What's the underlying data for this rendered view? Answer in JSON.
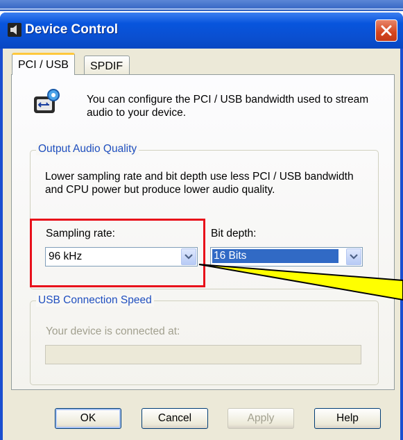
{
  "window": {
    "title": "Device Control"
  },
  "tabs": [
    {
      "label": "PCI / USB",
      "active": true
    },
    {
      "label": "SPDIF",
      "active": false
    }
  ],
  "intro": {
    "text": "You can configure the PCI / USB bandwidth used to stream audio to your device."
  },
  "output_quality": {
    "label": "Output Audio Quality",
    "description": "Lower sampling rate and bit depth use less PCI / USB bandwidth and CPU power but produce lower audio quality.",
    "sampling_rate_label": "Sampling rate:",
    "sampling_rate_value": "96 kHz",
    "bit_depth_label": "Bit depth:",
    "bit_depth_value": "16 Bits"
  },
  "usb_speed": {
    "label": "USB Connection Speed",
    "connected_label": "Your device is connected at:",
    "connected_value": ""
  },
  "buttons": {
    "ok": "OK",
    "cancel": "Cancel",
    "apply": "Apply",
    "help": "Help"
  },
  "colors": {
    "titlebar": "#0a4fd0",
    "highlight_box": "#e8101a",
    "callout_fill": "#ffff00",
    "selection": "#316ac5"
  }
}
